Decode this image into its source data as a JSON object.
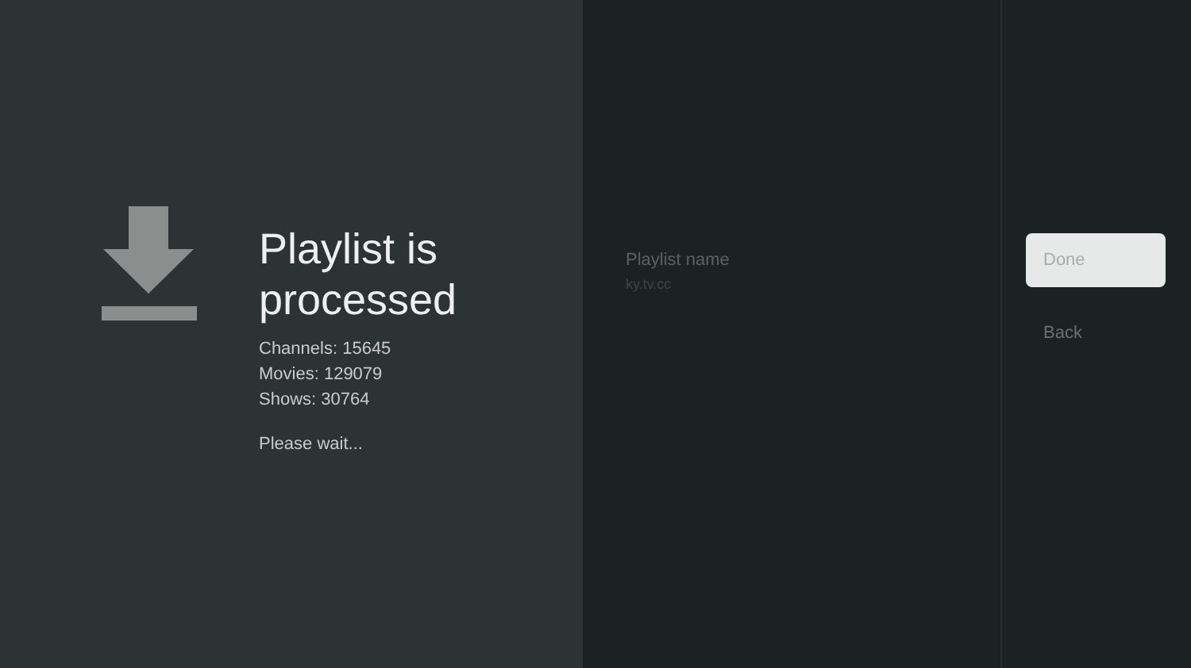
{
  "status": {
    "title": "Playlist is processed",
    "stats": [
      "Channels: 15645",
      "Movies: 129079",
      "Shows: 30764"
    ],
    "message": "Please wait..."
  },
  "details": {
    "label": "Playlist name",
    "value": "ky.tv.cc"
  },
  "actions": [
    {
      "label": "Done",
      "selected": true
    },
    {
      "label": "Back",
      "selected": false
    }
  ]
}
